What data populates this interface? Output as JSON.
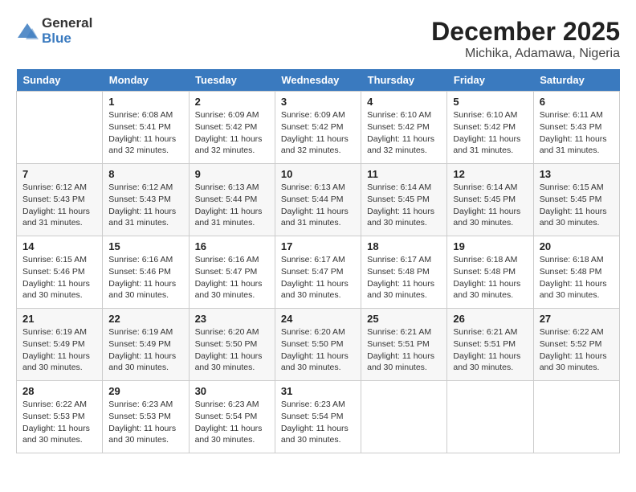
{
  "logo": {
    "general": "General",
    "blue": "Blue"
  },
  "title": {
    "month": "December 2025",
    "location": "Michika, Adamawa, Nigeria"
  },
  "headers": [
    "Sunday",
    "Monday",
    "Tuesday",
    "Wednesday",
    "Thursday",
    "Friday",
    "Saturday"
  ],
  "weeks": [
    [
      {
        "day": "",
        "sunrise": "",
        "sunset": "",
        "daylight": ""
      },
      {
        "day": "1",
        "sunrise": "Sunrise: 6:08 AM",
        "sunset": "Sunset: 5:41 PM",
        "daylight": "Daylight: 11 hours and 32 minutes."
      },
      {
        "day": "2",
        "sunrise": "Sunrise: 6:09 AM",
        "sunset": "Sunset: 5:42 PM",
        "daylight": "Daylight: 11 hours and 32 minutes."
      },
      {
        "day": "3",
        "sunrise": "Sunrise: 6:09 AM",
        "sunset": "Sunset: 5:42 PM",
        "daylight": "Daylight: 11 hours and 32 minutes."
      },
      {
        "day": "4",
        "sunrise": "Sunrise: 6:10 AM",
        "sunset": "Sunset: 5:42 PM",
        "daylight": "Daylight: 11 hours and 32 minutes."
      },
      {
        "day": "5",
        "sunrise": "Sunrise: 6:10 AM",
        "sunset": "Sunset: 5:42 PM",
        "daylight": "Daylight: 11 hours and 31 minutes."
      },
      {
        "day": "6",
        "sunrise": "Sunrise: 6:11 AM",
        "sunset": "Sunset: 5:43 PM",
        "daylight": "Daylight: 11 hours and 31 minutes."
      }
    ],
    [
      {
        "day": "7",
        "sunrise": "Sunrise: 6:12 AM",
        "sunset": "Sunset: 5:43 PM",
        "daylight": "Daylight: 11 hours and 31 minutes."
      },
      {
        "day": "8",
        "sunrise": "Sunrise: 6:12 AM",
        "sunset": "Sunset: 5:43 PM",
        "daylight": "Daylight: 11 hours and 31 minutes."
      },
      {
        "day": "9",
        "sunrise": "Sunrise: 6:13 AM",
        "sunset": "Sunset: 5:44 PM",
        "daylight": "Daylight: 11 hours and 31 minutes."
      },
      {
        "day": "10",
        "sunrise": "Sunrise: 6:13 AM",
        "sunset": "Sunset: 5:44 PM",
        "daylight": "Daylight: 11 hours and 31 minutes."
      },
      {
        "day": "11",
        "sunrise": "Sunrise: 6:14 AM",
        "sunset": "Sunset: 5:45 PM",
        "daylight": "Daylight: 11 hours and 30 minutes."
      },
      {
        "day": "12",
        "sunrise": "Sunrise: 6:14 AM",
        "sunset": "Sunset: 5:45 PM",
        "daylight": "Daylight: 11 hours and 30 minutes."
      },
      {
        "day": "13",
        "sunrise": "Sunrise: 6:15 AM",
        "sunset": "Sunset: 5:45 PM",
        "daylight": "Daylight: 11 hours and 30 minutes."
      }
    ],
    [
      {
        "day": "14",
        "sunrise": "Sunrise: 6:15 AM",
        "sunset": "Sunset: 5:46 PM",
        "daylight": "Daylight: 11 hours and 30 minutes."
      },
      {
        "day": "15",
        "sunrise": "Sunrise: 6:16 AM",
        "sunset": "Sunset: 5:46 PM",
        "daylight": "Daylight: 11 hours and 30 minutes."
      },
      {
        "day": "16",
        "sunrise": "Sunrise: 6:16 AM",
        "sunset": "Sunset: 5:47 PM",
        "daylight": "Daylight: 11 hours and 30 minutes."
      },
      {
        "day": "17",
        "sunrise": "Sunrise: 6:17 AM",
        "sunset": "Sunset: 5:47 PM",
        "daylight": "Daylight: 11 hours and 30 minutes."
      },
      {
        "day": "18",
        "sunrise": "Sunrise: 6:17 AM",
        "sunset": "Sunset: 5:48 PM",
        "daylight": "Daylight: 11 hours and 30 minutes."
      },
      {
        "day": "19",
        "sunrise": "Sunrise: 6:18 AM",
        "sunset": "Sunset: 5:48 PM",
        "daylight": "Daylight: 11 hours and 30 minutes."
      },
      {
        "day": "20",
        "sunrise": "Sunrise: 6:18 AM",
        "sunset": "Sunset: 5:48 PM",
        "daylight": "Daylight: 11 hours and 30 minutes."
      }
    ],
    [
      {
        "day": "21",
        "sunrise": "Sunrise: 6:19 AM",
        "sunset": "Sunset: 5:49 PM",
        "daylight": "Daylight: 11 hours and 30 minutes."
      },
      {
        "day": "22",
        "sunrise": "Sunrise: 6:19 AM",
        "sunset": "Sunset: 5:49 PM",
        "daylight": "Daylight: 11 hours and 30 minutes."
      },
      {
        "day": "23",
        "sunrise": "Sunrise: 6:20 AM",
        "sunset": "Sunset: 5:50 PM",
        "daylight": "Daylight: 11 hours and 30 minutes."
      },
      {
        "day": "24",
        "sunrise": "Sunrise: 6:20 AM",
        "sunset": "Sunset: 5:50 PM",
        "daylight": "Daylight: 11 hours and 30 minutes."
      },
      {
        "day": "25",
        "sunrise": "Sunrise: 6:21 AM",
        "sunset": "Sunset: 5:51 PM",
        "daylight": "Daylight: 11 hours and 30 minutes."
      },
      {
        "day": "26",
        "sunrise": "Sunrise: 6:21 AM",
        "sunset": "Sunset: 5:51 PM",
        "daylight": "Daylight: 11 hours and 30 minutes."
      },
      {
        "day": "27",
        "sunrise": "Sunrise: 6:22 AM",
        "sunset": "Sunset: 5:52 PM",
        "daylight": "Daylight: 11 hours and 30 minutes."
      }
    ],
    [
      {
        "day": "28",
        "sunrise": "Sunrise: 6:22 AM",
        "sunset": "Sunset: 5:53 PM",
        "daylight": "Daylight: 11 hours and 30 minutes."
      },
      {
        "day": "29",
        "sunrise": "Sunrise: 6:23 AM",
        "sunset": "Sunset: 5:53 PM",
        "daylight": "Daylight: 11 hours and 30 minutes."
      },
      {
        "day": "30",
        "sunrise": "Sunrise: 6:23 AM",
        "sunset": "Sunset: 5:54 PM",
        "daylight": "Daylight: 11 hours and 30 minutes."
      },
      {
        "day": "31",
        "sunrise": "Sunrise: 6:23 AM",
        "sunset": "Sunset: 5:54 PM",
        "daylight": "Daylight: 11 hours and 30 minutes."
      },
      {
        "day": "",
        "sunrise": "",
        "sunset": "",
        "daylight": ""
      },
      {
        "day": "",
        "sunrise": "",
        "sunset": "",
        "daylight": ""
      },
      {
        "day": "",
        "sunrise": "",
        "sunset": "",
        "daylight": ""
      }
    ]
  ]
}
